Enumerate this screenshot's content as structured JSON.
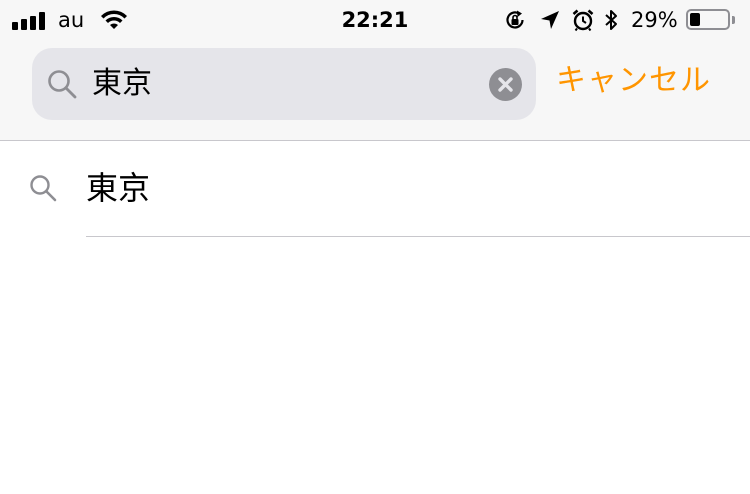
{
  "status_bar": {
    "carrier": "au",
    "time": "22:21",
    "battery_percent_text": "29%",
    "battery_level": 0.29,
    "signal_bars": 4,
    "icons": [
      "orientation-lock-icon",
      "location-arrow-icon",
      "alarm-icon",
      "bluetooth-icon"
    ]
  },
  "search": {
    "query": "東京",
    "cancel_label": "キャンセル"
  },
  "suggestions": [
    {
      "label": "東京"
    }
  ],
  "colors": {
    "accent": "#ff9500",
    "header_bg": "#f7f7f7",
    "field_bg": "#e5e5ea",
    "icon_gray": "#8e8e93",
    "separator": "#c8c7cc"
  }
}
